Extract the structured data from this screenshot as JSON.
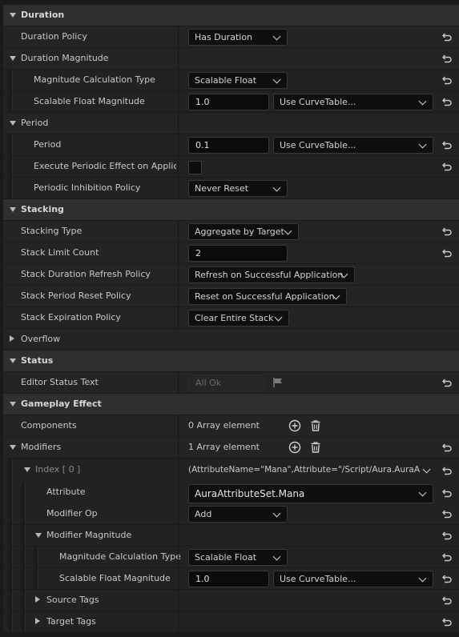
{
  "sections": {
    "duration": "Duration",
    "stacking": "Stacking",
    "status": "Status",
    "gameplay_effect": "Gameplay Effect"
  },
  "duration": {
    "policy_label": "Duration Policy",
    "policy_value": "Has Duration",
    "magnitude_label": "Duration Magnitude",
    "calc_type_label": "Magnitude Calculation Type",
    "calc_type_value": "Scalable Float",
    "scalable_label": "Scalable Float Magnitude",
    "scalable_value": "1.0",
    "curve_value": "Use CurveTable..."
  },
  "period": {
    "group_label": "Period",
    "period_label": "Period",
    "period_value": "0.1",
    "curve_value": "Use CurveTable...",
    "execute_label": "Execute Periodic Effect on Applica...",
    "inhibition_label": "Periodic Inhibition Policy",
    "inhibition_value": "Never Reset"
  },
  "stacking": {
    "type_label": "Stacking Type",
    "type_value": "Aggregate by Target",
    "limit_label": "Stack Limit Count",
    "limit_value": "2",
    "refresh_label": "Stack Duration Refresh Policy",
    "refresh_value": "Refresh on Successful Application",
    "reset_label": "Stack Period Reset Policy",
    "reset_value": "Reset on Successful Application",
    "expiration_label": "Stack Expiration Policy",
    "expiration_value": "Clear Entire Stack",
    "overflow_label": "Overflow"
  },
  "status": {
    "editor_label": "Editor Status Text",
    "editor_value": "All Ok"
  },
  "gameplay_effect": {
    "components_label": "Components",
    "components_value": "0 Array element",
    "modifiers_label": "Modifiers",
    "modifiers_value": "1 Array element",
    "index_label": "Index [ 0 ]",
    "index_value": "(AttributeName=\"Mana\",Attribute=\"/Script/Aura.AuraA",
    "attribute_label": "Attribute",
    "attribute_value": "AuraAttributeSet.Mana",
    "modifier_op_label": "Modifier Op",
    "modifier_op_value": "Add",
    "mod_magnitude_label": "Modifier Magnitude",
    "calc_type_label": "Magnitude Calculation Type",
    "calc_type_value": "Scalable Float",
    "scalable_label": "Scalable Float Magnitude",
    "scalable_value": "1.0",
    "curve_value": "Use CurveTable...",
    "source_tags_label": "Source Tags",
    "target_tags_label": "Target Tags"
  },
  "icons": {
    "reset": "reset-to-default-icon",
    "add": "add-element-icon",
    "delete": "delete-trash-icon",
    "flag": "status-flag-icon",
    "expand": "expand-arrow-icon"
  },
  "colors": {
    "background": "#1a1a1a",
    "category_row": "#2f2f2f",
    "property_row": "#242424",
    "input_bg": "#0b0b0b",
    "text": "#c8c8c8"
  }
}
